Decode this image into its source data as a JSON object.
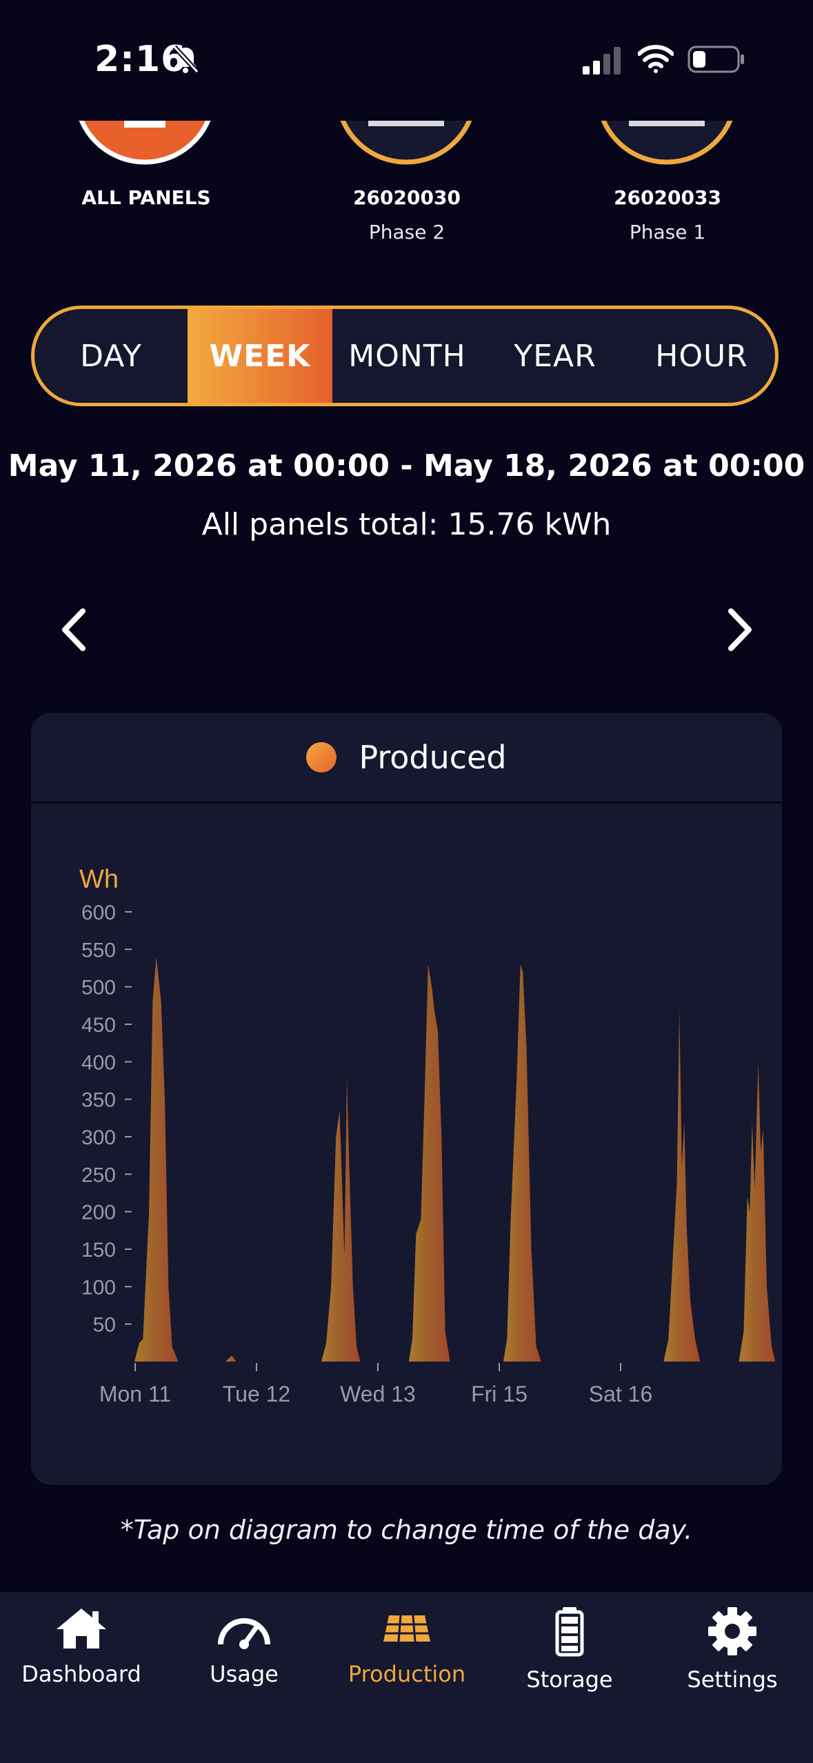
{
  "status_bar": {
    "time": "2:16"
  },
  "panels": [
    {
      "id": "ALL PANELS",
      "phase": ""
    },
    {
      "id": "26020030",
      "phase": "Phase 2"
    },
    {
      "id": "26020033",
      "phase": "Phase 1"
    }
  ],
  "segments": [
    {
      "label": "DAY",
      "active": false
    },
    {
      "label": "WEEK",
      "active": true
    },
    {
      "label": "MONTH",
      "active": false
    },
    {
      "label": "YEAR",
      "active": false
    },
    {
      "label": "HOUR",
      "active": false
    }
  ],
  "range": "May 11, 2026 at 00:00 - May 18, 2026 at 00:00",
  "total": "All panels total: 15.76 kWh",
  "legend": "Produced",
  "chart_data": {
    "type": "area",
    "ylabel": "Wh",
    "ylim": [
      0,
      600
    ],
    "yticks": [
      50,
      100,
      150,
      200,
      250,
      300,
      350,
      400,
      450,
      500,
      550,
      600
    ],
    "xticks": [
      {
        "label": "Mon 11",
        "day": 0
      },
      {
        "label": "Tue 12",
        "day": 1
      },
      {
        "label": "Wed 13",
        "day": 2
      },
      {
        "label": "Fri 15",
        "day": 3
      },
      {
        "label": "Sat 16",
        "day": 4
      }
    ],
    "series": [
      {
        "name": "Produced",
        "points": [
          [
            0.0,
            0
          ],
          [
            0.04,
            25
          ],
          [
            0.07,
            30
          ],
          [
            0.12,
            200
          ],
          [
            0.15,
            480
          ],
          [
            0.18,
            540
          ],
          [
            0.2,
            510
          ],
          [
            0.22,
            480
          ],
          [
            0.25,
            350
          ],
          [
            0.28,
            100
          ],
          [
            0.31,
            20
          ],
          [
            0.36,
            0
          ],
          [
            0.75,
            0
          ],
          [
            0.8,
            8
          ],
          [
            0.84,
            0
          ],
          [
            1.54,
            0
          ],
          [
            1.58,
            25
          ],
          [
            1.62,
            100
          ],
          [
            1.66,
            300
          ],
          [
            1.69,
            335
          ],
          [
            1.71,
            240
          ],
          [
            1.73,
            140
          ],
          [
            1.75,
            380
          ],
          [
            1.77,
            260
          ],
          [
            1.8,
            100
          ],
          [
            1.83,
            20
          ],
          [
            1.86,
            0
          ],
          [
            2.26,
            0
          ],
          [
            2.29,
            30
          ],
          [
            2.32,
            170
          ],
          [
            2.36,
            190
          ],
          [
            2.39,
            350
          ],
          [
            2.42,
            530
          ],
          [
            2.45,
            500
          ],
          [
            2.47,
            470
          ],
          [
            2.5,
            440
          ],
          [
            2.53,
            300
          ],
          [
            2.56,
            40
          ],
          [
            2.6,
            0
          ],
          [
            3.04,
            0
          ],
          [
            3.07,
            30
          ],
          [
            3.1,
            190
          ],
          [
            3.15,
            380
          ],
          [
            3.18,
            530
          ],
          [
            3.2,
            520
          ],
          [
            3.23,
            420
          ],
          [
            3.27,
            150
          ],
          [
            3.31,
            20
          ],
          [
            3.35,
            0
          ],
          [
            4.36,
            0
          ],
          [
            4.4,
            30
          ],
          [
            4.44,
            150
          ],
          [
            4.47,
            240
          ],
          [
            4.49,
            470
          ],
          [
            4.51,
            260
          ],
          [
            4.53,
            320
          ],
          [
            4.55,
            180
          ],
          [
            4.58,
            80
          ],
          [
            4.62,
            30
          ],
          [
            4.66,
            0
          ],
          [
            4.98,
            0
          ],
          [
            5.02,
            40
          ],
          [
            5.05,
            220
          ],
          [
            5.07,
            200
          ],
          [
            5.09,
            320
          ],
          [
            5.11,
            230
          ],
          [
            5.14,
            400
          ],
          [
            5.16,
            280
          ],
          [
            5.18,
            310
          ],
          [
            5.21,
            100
          ],
          [
            5.25,
            20
          ],
          [
            5.28,
            0
          ]
        ]
      }
    ]
  },
  "hint": "*Tap on diagram to change time of the day.",
  "tabs": [
    {
      "label": "Dashboard",
      "icon": "home-icon",
      "active": false
    },
    {
      "label": "Usage",
      "icon": "gauge-icon",
      "active": false
    },
    {
      "label": "Production",
      "icon": "solar-panel-icon",
      "active": true
    },
    {
      "label": "Storage",
      "icon": "battery-icon",
      "active": false
    },
    {
      "label": "Settings",
      "icon": "gear-icon",
      "active": false
    }
  ],
  "colors": {
    "accent": "#f0a83c",
    "accent_end": "#e5602c",
    "background": "#06051a",
    "card": "#15182f"
  }
}
